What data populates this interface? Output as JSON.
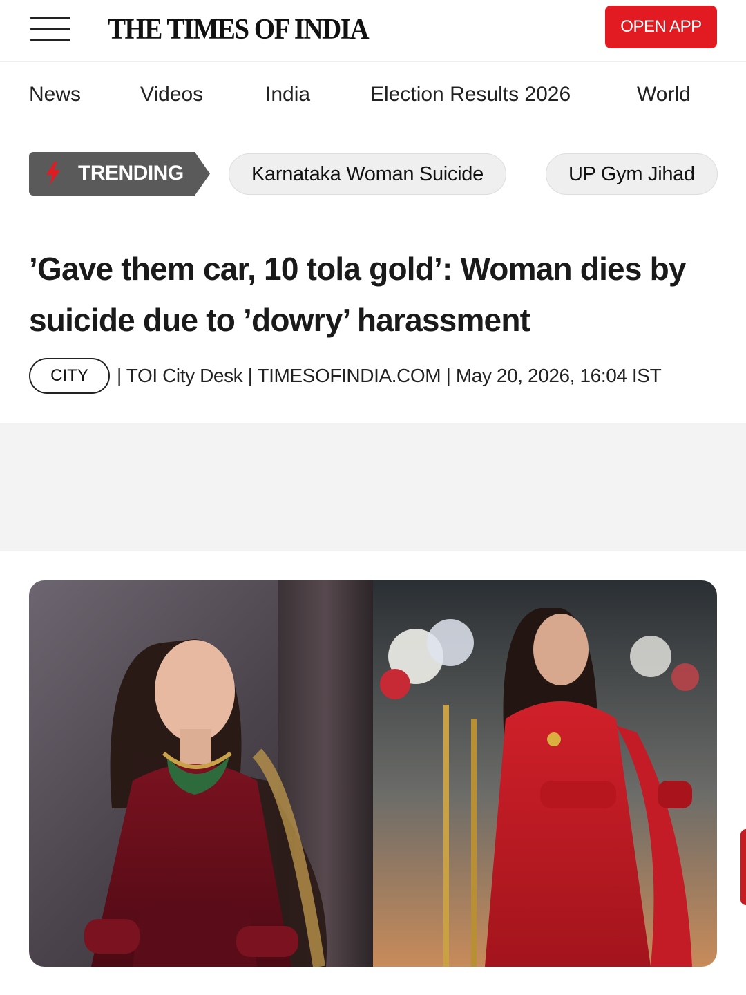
{
  "header": {
    "logo_text": "THE TIMES OF INDIA",
    "open_app_label": "OPEN APP",
    "menu_icon": "hamburger-menu-icon"
  },
  "nav": {
    "items": [
      "News",
      "Videos",
      "India",
      "Election Results 2026",
      "World"
    ]
  },
  "trending": {
    "label": "TRENDING",
    "icon": "lightning-bolt-icon",
    "topics": [
      "Karnataka Woman Suicide",
      "UP Gym Jihad"
    ]
  },
  "article": {
    "headline": "’Gave them car, 10 tola gold’: Woman dies by suicide due to ’dowry’ harassment",
    "category": "CITY",
    "byline": "| TOI City Desk | TIMESOFINDIA.COM | May 20, 2026, 16:04 IST"
  },
  "colors": {
    "brand_red": "#e21b22",
    "trending_bg": "#5a5a5a",
    "chip_bg": "#efefef",
    "ad_bg": "#f3f3f3"
  }
}
